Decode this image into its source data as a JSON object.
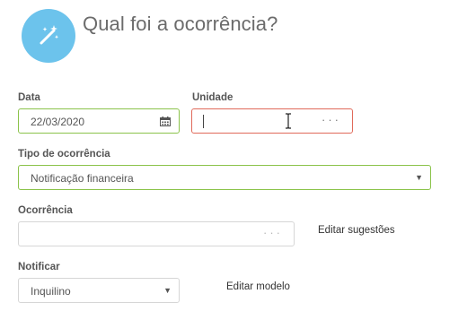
{
  "header": {
    "title": "Qual foi a ocorrência?",
    "icon": "magic-wand-icon",
    "icon_color": "#6cc3ec"
  },
  "form": {
    "data": {
      "label": "Data",
      "value": "22/03/2020",
      "icon": "calendar-icon"
    },
    "unidade": {
      "label": "Unidade",
      "value": "",
      "more": "···"
    },
    "tipo": {
      "label": "Tipo de ocorrência",
      "value": "Notificação financeira"
    },
    "ocorrencia": {
      "label": "Ocorrência",
      "value": "",
      "more": "···",
      "edit_link": "Editar sugestões"
    },
    "notificar": {
      "label": "Notificar",
      "value": "Inquilino",
      "edit_link": "Editar modelo"
    }
  },
  "colors": {
    "valid_border": "#8bc34a",
    "error_border": "#e06a5a",
    "accent": "#6cc3ec"
  }
}
